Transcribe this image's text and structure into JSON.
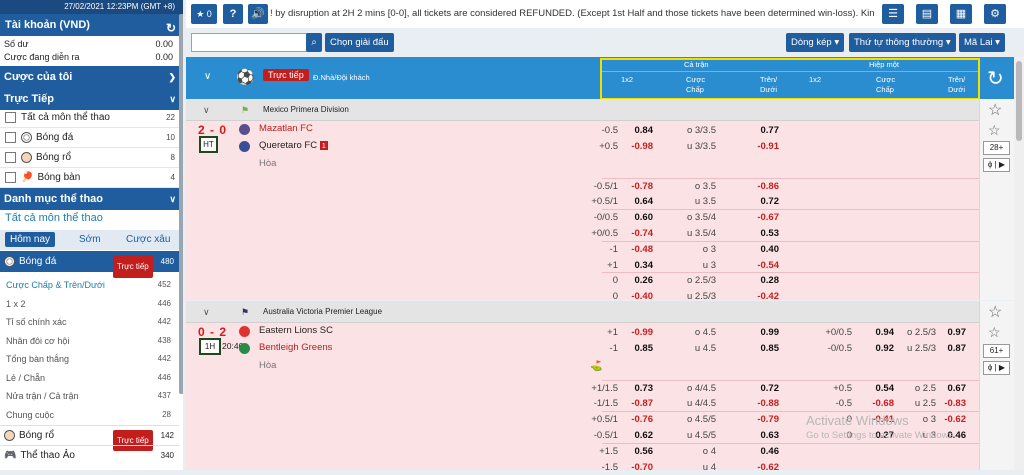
{
  "sidebar": {
    "datetime": "27/02/2021 12:23PM (GMT +8)",
    "account_title": "Tài khoản (VND)",
    "balance_label": "Số dư",
    "balance_value": "0.00",
    "pending_label": "Cược đang diễn ra",
    "pending_value": "0.00",
    "my_bets": "Cược của tôi",
    "live_head": "Trực Tiếp",
    "live_items": [
      {
        "label": "Tất cả môn thể thao",
        "count": "22"
      },
      {
        "label": "Bóng đá",
        "count": "10"
      },
      {
        "label": "Bóng rổ",
        "count": "8"
      },
      {
        "label": "Bóng bàn",
        "count": "4"
      }
    ],
    "sports_head": "Danh mục thể thao",
    "all_sports": "Tất cả môn thể thao",
    "tabs": [
      "Hôm nay",
      "Sớm",
      "Cược xâu"
    ],
    "football": {
      "label": "Bóng đá",
      "live": "Trực tiếp",
      "count": "480"
    },
    "sub_items": [
      {
        "label": "Cược Chấp & Trên/Dưới",
        "count": "452"
      },
      {
        "label": "1 x 2",
        "count": "446"
      },
      {
        "label": "Tỉ số chính xác",
        "count": "442"
      },
      {
        "label": "Nhân đôi cơ hội",
        "count": "438"
      },
      {
        "label": "Tổng bàn thắng",
        "count": "442"
      },
      {
        "label": "Lẻ / Chẵn",
        "count": "446"
      },
      {
        "label": "Nửa trận / Cả trận",
        "count": "437"
      },
      {
        "label": "Chung cuộc",
        "count": "28"
      }
    ],
    "basketball": {
      "label": "Bóng rổ",
      "live": "Trực tiếp",
      "count": "142"
    },
    "virtual": {
      "label": "Thể thao Ảo",
      "count": "340"
    }
  },
  "topbar": {
    "star_count": "0",
    "ticker": "! by disruption at 2H 2 mins [0-0], all tickets are considered REFUNDED. (Except 1st Half and those tickets have been determined win-loss). Kindly re-c"
  },
  "filter": {
    "search_placeholder": "",
    "select_league": "Chọn giải đấu",
    "line_mode": "Dòng kép",
    "sort": "Thứ tự thông thường",
    "odds_type": "Mã Lai"
  },
  "header": {
    "live_label": "Trực tiếp",
    "home_away": "Đ.Nhà/Đội khách",
    "full_time": "Cả trận",
    "first_half": "Hiệp một",
    "col_1x2": "1x2",
    "col_hdp": [
      "Cược",
      "Chấp"
    ],
    "col_ou": [
      "Trên/",
      "Dưới"
    ]
  },
  "leagues": [
    {
      "name": "Mexico Primera Division",
      "score": "2 - 0",
      "status": "HT",
      "home": "Mazatlan FC",
      "away": "Queretaro FC",
      "red_cards": "1",
      "draw": "Hòa",
      "more": "28+",
      "rows": [
        {
          "hdp": "-0.5",
          "hdp_odds": "0.84",
          "ou": "o 3/3.5",
          "ou_odds": "0.77"
        },
        {
          "hdp": "+0.5",
          "hdp_odds": "-0.98",
          "ou": "u 3/3.5",
          "ou_odds": "-0.91"
        },
        {
          "hdp": "-0.5/1",
          "hdp_odds": "-0.78",
          "ou": "o 3.5",
          "ou_odds": "-0.86"
        },
        {
          "hdp": "+0.5/1",
          "hdp_odds": "0.64",
          "ou": "u 3.5",
          "ou_odds": "0.72"
        },
        {
          "hdp": "-0/0.5",
          "hdp_odds": "0.60",
          "ou": "o 3.5/4",
          "ou_odds": "-0.67"
        },
        {
          "hdp": "+0/0.5",
          "hdp_odds": "-0.74",
          "ou": "u 3.5/4",
          "ou_odds": "0.53"
        },
        {
          "hdp": "-1",
          "hdp_odds": "-0.48",
          "ou": "o 3",
          "ou_odds": "0.40"
        },
        {
          "hdp": "+1",
          "hdp_odds": "0.34",
          "ou": "u 3",
          "ou_odds": "-0.54"
        },
        {
          "hdp": "0",
          "hdp_odds": "0.26",
          "ou": "o 2.5/3",
          "ou_odds": "0.28"
        },
        {
          "hdp": "0",
          "hdp_odds": "-0.40",
          "ou": "u 2.5/3",
          "ou_odds": "-0.42"
        }
      ]
    },
    {
      "name": "Australia Victoria Premier League",
      "score": "0 - 2",
      "status": "1H",
      "time": "20:46",
      "home": "Eastern Lions SC",
      "away": "Bentleigh Greens",
      "draw": "Hòa",
      "more": "61+",
      "rows": [
        {
          "hdp": "+1",
          "hdp_odds": "-0.99",
          "ou": "o 4.5",
          "ou_odds": "0.99",
          "h_hdp": "+0/0.5",
          "h_hdp_odds": "0.94",
          "h_ou": "o 2.5/3",
          "h_ou_odds": "0.97"
        },
        {
          "hdp": "-1",
          "hdp_odds": "0.85",
          "ou": "u 4.5",
          "ou_odds": "0.85",
          "h_hdp": "-0/0.5",
          "h_hdp_odds": "0.92",
          "h_ou": "u 2.5/3",
          "h_ou_odds": "0.87"
        },
        {
          "hdp": "+1/1.5",
          "hdp_odds": "0.73",
          "ou": "o 4/4.5",
          "ou_odds": "0.72",
          "h_hdp": "+0.5",
          "h_hdp_odds": "0.54",
          "h_ou": "o 2.5",
          "h_ou_odds": "0.67"
        },
        {
          "hdp": "-1/1.5",
          "hdp_odds": "-0.87",
          "ou": "u 4/4.5",
          "ou_odds": "-0.88",
          "h_hdp": "-0.5",
          "h_hdp_odds": "-0.68",
          "h_ou": "u 2.5",
          "h_ou_odds": "-0.83"
        },
        {
          "hdp": "+0.5/1",
          "hdp_odds": "-0.76",
          "ou": "o 4.5/5",
          "ou_odds": "-0.79",
          "h_hdp": "0",
          "h_hdp_odds": "-0.41",
          "h_ou": "o 3",
          "h_ou_odds": "-0.62"
        },
        {
          "hdp": "-0.5/1",
          "hdp_odds": "0.62",
          "ou": "u 4.5/5",
          "ou_odds": "0.63",
          "h_hdp": "0",
          "h_hdp_odds": "0.27",
          "h_ou": "u 3",
          "h_ou_odds": "0.46"
        },
        {
          "hdp": "+1.5",
          "hdp_odds": "0.56",
          "ou": "o 4",
          "ou_odds": "0.46"
        },
        {
          "hdp": "-1.5",
          "hdp_odds": "-0.70",
          "ou": "u 4",
          "ou_odds": "-0.62"
        }
      ]
    }
  ],
  "watermark": {
    "title": "Activate Windows",
    "subtitle": "Go to Settings to activate Windows."
  },
  "colors": {
    "primary": "#1f5d9e",
    "header": "#2a8dd0",
    "match_bg": "#fbe2e4",
    "negative": "#c91e1e",
    "highlight": "#f0e000"
  }
}
